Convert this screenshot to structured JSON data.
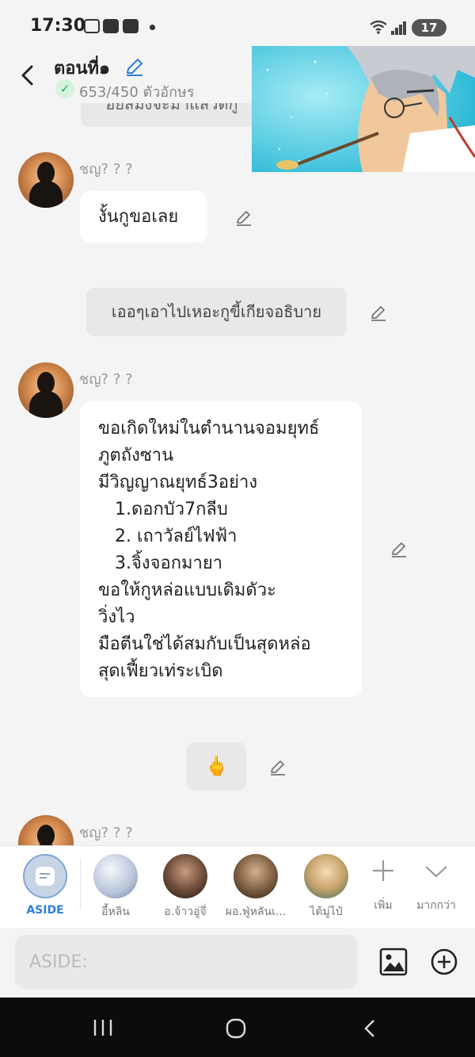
{
  "status": {
    "time": "17:30",
    "battery": "17"
  },
  "header": {
    "title": "ตอนที่๑",
    "count": "653/450 ตัวอักษร"
  },
  "chat": {
    "top_partial": "อยสมงจะมาแสวตกู",
    "messages": [
      {
        "speaker": "ชญ? ? ?",
        "lines": [
          "งั้นกูขอเลย"
        ]
      },
      {
        "aside": "เออๆเอาไปเหอะกูขี้เกียจอธิบาย"
      },
      {
        "speaker": "ชญ? ? ?",
        "lines": [
          "ขอเกิดใหม่ในตำนานจอมยุทธ์",
          "ภูตถังซาน",
          "มีวิญญาณยุทธ์3อย่าง",
          "   1.ดอกบัว7กลีบ",
          "   2. เถาวัลย์ไฟฟ้า",
          "   3.จิ้งจอกมายา",
          "ขอให้กูหล่อแบบเดิมดัวะ",
          "วิ่งไว",
          "มือตีนใช่ได้สมกับเป็นสุดหล่อ",
          "สุดเฟี้ยวเท่ระเบิด"
        ]
      },
      {
        "aside_emoji": "🖕"
      },
      {
        "speaker": "ชญ? ? ?"
      }
    ]
  },
  "characters": {
    "aside_label": "ASIDE",
    "items": [
      "อี้หลิน",
      "อ.จ้าวอู่จี่",
      "ผอ.ฟู่หลันเ...",
      "ไต้มู่ไป๋"
    ],
    "add_label": "เพิ่ม",
    "more_label": "มากกว่า"
  },
  "input": {
    "placeholder": "ASIDE:"
  },
  "colors": {
    "accent": "#2f7fe0",
    "background": "#f4f4f4",
    "bubble": "#ffffff",
    "aside": "#e8e8e8"
  }
}
